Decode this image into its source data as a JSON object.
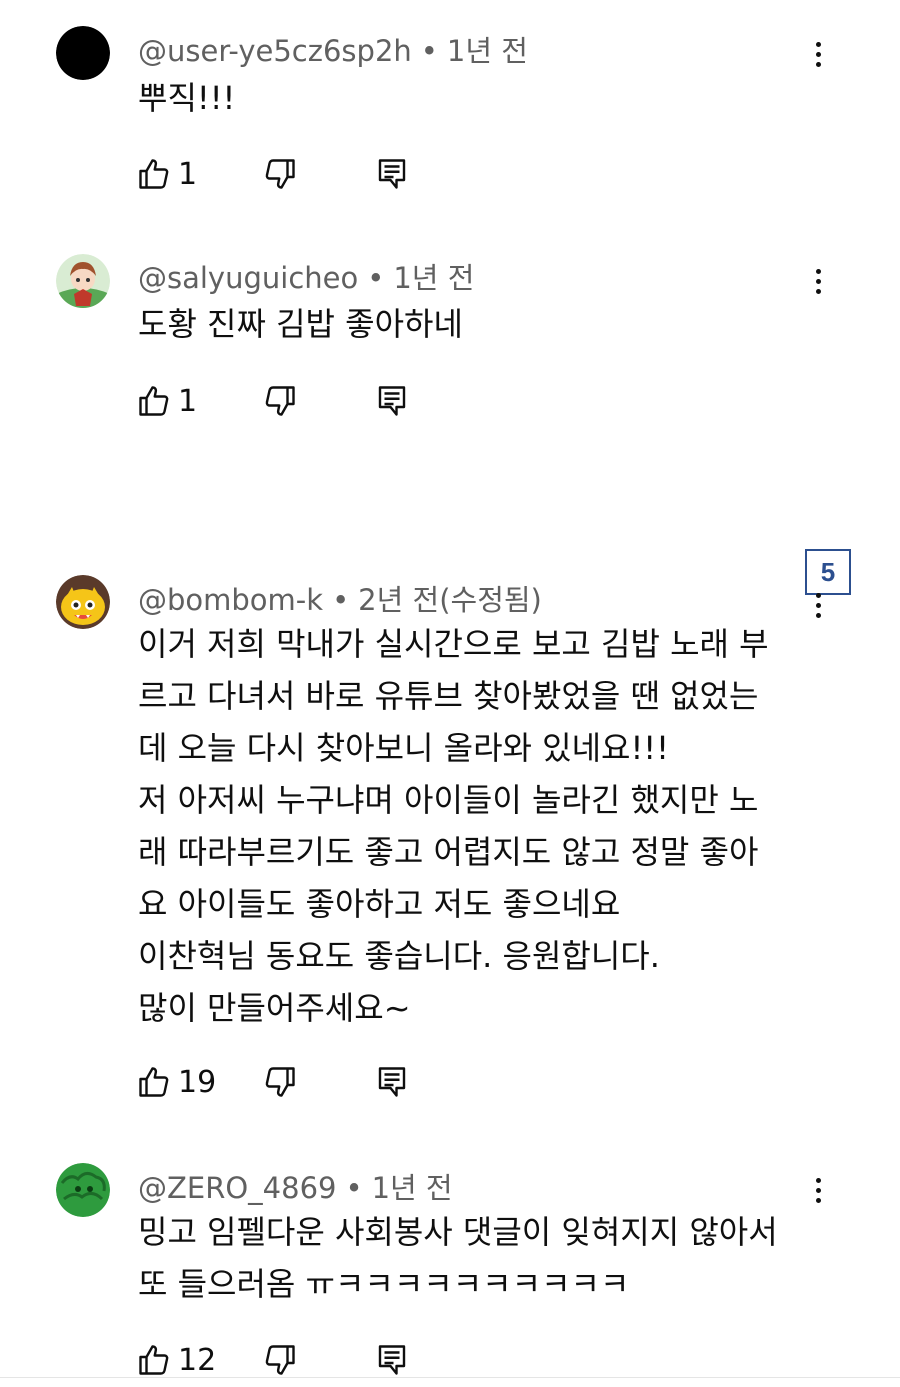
{
  "comments": [
    {
      "author": "@user-ye5cz6sp2h",
      "time": "1년 전",
      "lines": [
        "뿌직!!!"
      ],
      "likes": "1",
      "avatar_color": "#000000"
    },
    {
      "author": "@salyuguicheo",
      "time": "1년 전",
      "lines": [
        "도황 진짜 김밥 좋아하네"
      ],
      "likes": "1",
      "avatar_color": "#6fae6a"
    },
    {
      "author": "@bombom-k",
      "time": "2년 전(수정됨)",
      "lines": [
        "이거 저희 막내가 실시간으로 보고 김밥 노래 부",
        "르고 다녀서 바로 유튜브 찾아봤었을 땐 없었는",
        "데 오늘 다시 찾아보니 올라와 있네요!!!",
        "저 아저씨 누구냐며 아이들이 놀라긴 했지만 노",
        "래 따라부르기도 좋고 어렵지도 않고 정말 좋아",
        "요 아이들도 좋아하고 저도 좋으네요",
        "이찬혁님 동요도 좋습니다. 응원합니다.",
        "많이 만들어주세요~"
      ],
      "likes": "19",
      "avatar_color": "#f5c518"
    },
    {
      "author": "@ZERO_4869",
      "time": "1년 전",
      "lines": [
        "밍고 임펠다운 사회봉사 댓글이 잊혀지지 않아서",
        "또 들으러옴 ㅠㅋㅋㅋㅋㅋㅋㅋㅋㅋㅋ"
      ],
      "likes": "12",
      "avatar_color": "#2e9b3e"
    }
  ],
  "badge": "5",
  "icons": {
    "like": "thumbs-up-icon",
    "dislike": "thumbs-down-icon",
    "reply": "reply-icon",
    "more": "more-vert-icon"
  }
}
